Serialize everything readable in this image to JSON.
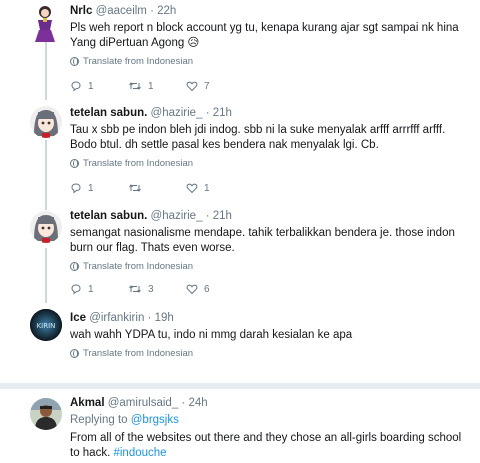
{
  "tweets": [
    {
      "name": "Nrlc",
      "handle": "@aaceilm",
      "time": "22h",
      "text": "Pls weh report n block account yg tu, kenapa kurang ajar sgt sampai nk hina Yang diPertuan Agong 😥",
      "translate": "Translate from Indonesian",
      "reply_count": "1",
      "retweet_count": "1",
      "like_count": "7"
    },
    {
      "name": "tetelan sabun.",
      "handle": "@hazirie_",
      "time": "21h",
      "text": "Tau x sbb pe indon bleh jdi indog. sbb ni la suke menyalak arfff arrrfff arfff. Bodo btul. dh settle pasal kes bendera nak menyalak lgi. Cb.",
      "translate": "Translate from Indonesian",
      "reply_count": "1",
      "retweet_count": "",
      "like_count": "1"
    },
    {
      "name": "tetelan sabun.",
      "handle": "@hazirie_",
      "time": "21h",
      "text": "semangat nasionalisme mendape. tahik terbalikkan bendera je. those indon burn our flag. Thats even worse.",
      "translate": "Translate from Indonesian",
      "reply_count": "1",
      "retweet_count": "3",
      "like_count": "6"
    },
    {
      "name": "Ice",
      "handle": "@irfankirin",
      "time": "19h",
      "text": "wah wahh YDPA tu, indo ni mmg darah kesialan ke apa",
      "translate": "Translate from Indonesian",
      "avatar_text": "KIRIN"
    },
    {
      "name": "Akmal",
      "handle": "@amirulsaid_",
      "time": "24h",
      "replying_prefix": "Replying to",
      "replying_to": "@brgsjks",
      "text": "From all of the websites out there and they chose an all-girls boarding school to hack.",
      "hashtag": "#indouche"
    }
  ],
  "separator_dot": "·",
  "colors": {
    "accent": "#1b95e0",
    "muted": "#657786",
    "line": "#ccd6dd"
  }
}
